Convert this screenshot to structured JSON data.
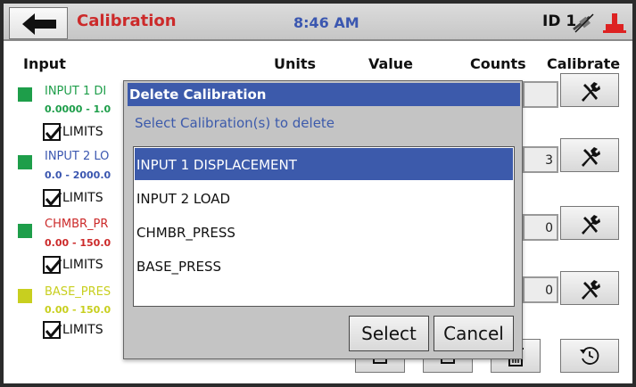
{
  "titlebar": {
    "title": "Calibration",
    "time": "8:46 AM",
    "device_id": "ID 1"
  },
  "table": {
    "headers": {
      "input": "Input",
      "units": "Units",
      "value": "Value",
      "counts": "Counts",
      "calibrate": "Calibrate"
    },
    "rows": [
      {
        "name": "INPUT 1 DI",
        "range": "0.0000 - 1.0",
        "color": "#1e9e4a",
        "range_color": "#1e9e4a",
        "limits_label": "LIMITS",
        "limits_checked": true,
        "count": ""
      },
      {
        "name": "INPUT 2 LO",
        "range": "0.0 - 2000.0",
        "color": "#1e9e4a",
        "range_color": "#3b57b0",
        "limits_label": "LIMITS",
        "limits_checked": true,
        "count": "3"
      },
      {
        "name": "CHMBR_PR",
        "range": "0.00 - 150.0",
        "color": "#1e9e4a",
        "range_color": "#cc2a2a",
        "limits_label": "LIMITS",
        "limits_checked": true,
        "count": "0"
      },
      {
        "name": "BASE_PRES",
        "range": "0.00 - 150.0",
        "color": "#c8cf1f",
        "range_color": "#c8cf1f",
        "limits_label": "LIMITS",
        "limits_checked": true,
        "count": "0"
      }
    ]
  },
  "dialog": {
    "title": "Delete Calibration",
    "prompt": "Select Calibration(s) to delete",
    "items": [
      "INPUT 1 DISPLACEMENT",
      "INPUT 2 LOAD",
      "CHMBR_PRESS",
      "BASE_PRESS"
    ],
    "selected_index": 0,
    "select_label": "Select",
    "cancel_label": "Cancel"
  },
  "colors": {
    "accent_blue": "#3c5aab",
    "title_red": "#cc2a2a",
    "swatch_green": "#1e9e4a",
    "swatch_yellow": "#c8cf1f"
  },
  "icons": {
    "back": "arrow-left-icon",
    "usb": "usb-disconnected-icon",
    "power": "power-plug-icon",
    "calibrate": "wrench-screwdriver-icon",
    "history": "restore-icon",
    "delete": "trash-icon"
  }
}
